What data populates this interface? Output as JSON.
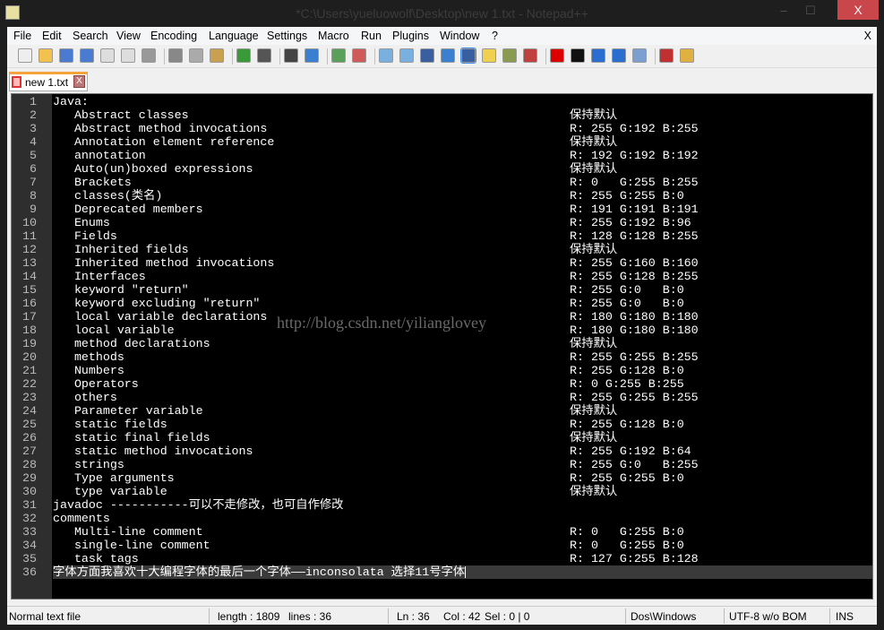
{
  "window": {
    "title": "*C:\\Users\\yueluowolf\\Desktop\\new  1.txt - Notepad++",
    "minimize": "–",
    "maximize": "☐",
    "close": "X"
  },
  "menu": [
    "File",
    "Edit",
    "Search",
    "View",
    "Encoding",
    "Language",
    "Settings",
    "Macro",
    "Run",
    "Plugins",
    "Window",
    "?"
  ],
  "menu_close": "X",
  "toolbar": [
    "new-file",
    "open-file",
    "save",
    "save-all",
    "close",
    "close-all",
    "print",
    "cut",
    "copy",
    "paste",
    "undo",
    "redo",
    "find",
    "replace",
    "zoom-in",
    "zoom-out",
    "sync-vertical",
    "sync-horizontal",
    "word-wrap",
    "show-all-chars",
    "indent-guide",
    "user-defined-language",
    "document-map",
    "function-list",
    "record-macro",
    "stop-record",
    "play-macro",
    "run-macro-multiple",
    "save-macro",
    "spell-check",
    "clipboard-history"
  ],
  "tab": {
    "label": "new  1.txt",
    "close": "X",
    "color": "#f5a33c"
  },
  "editor": {
    "current_line": 36,
    "lines": [
      [
        "Java:",
        ""
      ],
      [
        "   Abstract classes",
        "保持默认"
      ],
      [
        "   Abstract method invocations",
        "R: 255 G:192 B:255"
      ],
      [
        "   Annotation element reference",
        "保持默认"
      ],
      [
        "   annotation",
        "R: 192 G:192 B:192"
      ],
      [
        "   Auto(un)boxed expressions",
        "保持默认"
      ],
      [
        "   Brackets",
        "R: 0   G:255 B:255"
      ],
      [
        "   classes(类名)",
        "R: 255 G:255 B:0"
      ],
      [
        "   Deprecated members",
        "R: 191 G:191 B:191"
      ],
      [
        "   Enums",
        "R: 255 G:192 B:96"
      ],
      [
        "   Fields",
        "R: 128 G:128 B:255"
      ],
      [
        "   Inherited fields",
        "保持默认"
      ],
      [
        "   Inherited method invocations",
        "R: 255 G:160 B:160"
      ],
      [
        "   Interfaces",
        "R: 255 G:128 B:255"
      ],
      [
        "   keyword \"return\"",
        "R: 255 G:0   B:0"
      ],
      [
        "   keyword excluding \"return\"",
        "R: 255 G:0   B:0"
      ],
      [
        "   local variable declarations",
        "R: 180 G:180 B:180"
      ],
      [
        "   local variable",
        "R: 180 G:180 B:180"
      ],
      [
        "   method declarations",
        "保持默认"
      ],
      [
        "   methods",
        "R: 255 G:255 B:255"
      ],
      [
        "   Numbers",
        "R: 255 G:128 B:0"
      ],
      [
        "   Operators",
        "R: 0 G:255 B:255"
      ],
      [
        "   others",
        "R: 255 G:255 B:255"
      ],
      [
        "   Parameter variable",
        "保持默认"
      ],
      [
        "   static fields",
        "R: 255 G:128 B:0"
      ],
      [
        "   static final fields",
        "保持默认"
      ],
      [
        "   static method invocations",
        "R: 255 G:192 B:64"
      ],
      [
        "   strings",
        "R: 255 G:0   B:255"
      ],
      [
        "   Type arguments",
        "R: 255 G:255 B:0"
      ],
      [
        "   type variable",
        "保持默认"
      ],
      [
        "javadoc -----------可以不走修改，也可自作修改",
        ""
      ],
      [
        "comments",
        ""
      ],
      [
        "   Multi-line comment",
        "R: 0   G:255 B:0"
      ],
      [
        "   single-line comment",
        "R: 0   G:255 B:0"
      ],
      [
        "   task tags",
        "R: 127 G:255 B:128"
      ],
      [
        "字体方面我喜欢十大编程字体的最后一个字体——inconsolata 选择11号字体",
        ""
      ]
    ]
  },
  "watermark": "http://blog.csdn.net/yilianglovey",
  "status": {
    "type": "Normal text file",
    "length": "length : 1809",
    "lines": "lines : 36",
    "ln": "Ln : 36",
    "col": "Col : 42",
    "sel": "Sel : 0 | 0",
    "eol": "Dos\\Windows",
    "encoding": "UTF-8 w/o BOM",
    "mode": "INS"
  }
}
